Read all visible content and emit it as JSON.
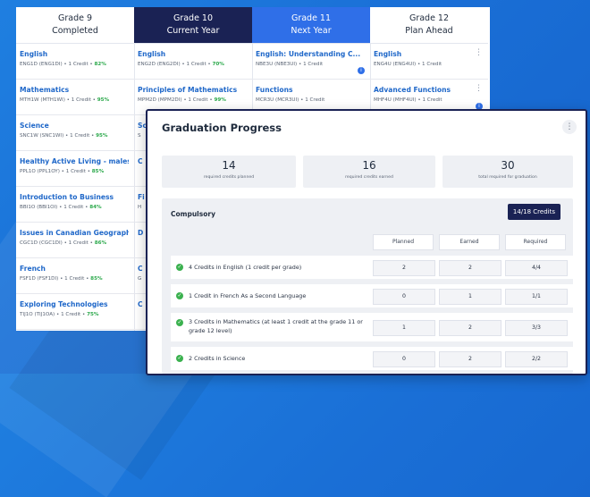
{
  "planner": {
    "columns": [
      {
        "line1": "Grade 9",
        "line2": "Completed",
        "courses": [
          {
            "title": "English",
            "sub": "ENG1D (ENG1DI) • 1 Credit • ",
            "pct": "82%"
          },
          {
            "title": "Mathematics",
            "sub": "MTH1W (MTH1WI) • 1 Credit • ",
            "pct": "95%"
          },
          {
            "title": "Science",
            "sub": "SNC1W (SNC1WI) • 1 Credit • ",
            "pct": "95%"
          },
          {
            "title": "Healthy Active Living - males",
            "sub": "PPL1O (PPL1OY) • 1 Credit • ",
            "pct": "85%"
          },
          {
            "title": "Introduction to Business",
            "sub": "BBI1O (BBI1OI) • 1 Credit • ",
            "pct": "84%"
          },
          {
            "title": "Issues in Canadian Geography",
            "sub": "CGC1D (CGC1DI) • 1 Credit • ",
            "pct": "86%"
          },
          {
            "title": "French",
            "sub": "FSF1D (FSF1DI) • 1 Credit • ",
            "pct": "85%"
          },
          {
            "title": "Exploring Technologies",
            "sub": "TIJ1O (TIJ1OA) • 1 Credit • ",
            "pct": "75%"
          }
        ]
      },
      {
        "line1": "Grade 10",
        "line2": "Current Year",
        "courses": [
          {
            "title": "English",
            "sub": "ENG2D (ENG2DI) • 1 Credit • ",
            "pct": "70%"
          },
          {
            "title": "Principles of Mathematics",
            "sub": "MPM2D (MPM2DI) • 1 Credit • ",
            "pct": "99%"
          },
          {
            "title": "Sc",
            "sub": "S",
            "pct": ""
          },
          {
            "title": "C",
            "sub": "",
            "pct": ""
          },
          {
            "title": "Fi",
            "sub": "H",
            "pct": ""
          },
          {
            "title": "D",
            "sub": "",
            "pct": ""
          },
          {
            "title": "C",
            "sub": "G",
            "pct": ""
          },
          {
            "title": "C",
            "sub": "",
            "pct": ""
          }
        ]
      },
      {
        "line1": "Grade 11",
        "line2": "Next Year",
        "courses": [
          {
            "title": "English: Understanding C...",
            "sub": "NBE3U (NBE3UI) • 1 Credit",
            "pct": ""
          },
          {
            "title": "Functions",
            "sub": "MCR3U (MCR3UI) • 1 Credit",
            "pct": ""
          }
        ]
      },
      {
        "line1": "Grade 12",
        "line2": "Plan Ahead",
        "courses": [
          {
            "title": "English",
            "sub": "ENG4U (ENG4UI) • 1 Credit",
            "pct": ""
          },
          {
            "title": "Advanced Functions",
            "sub": "MHF4U (MHF4UI) • 1 Credit",
            "pct": ""
          }
        ]
      }
    ]
  },
  "progress": {
    "title": "Graduation Progress",
    "stats": [
      {
        "num": "14",
        "label": "required credits planned"
      },
      {
        "num": "16",
        "label": "required credits earned"
      },
      {
        "num": "30",
        "label": "total required for graduation"
      }
    ],
    "section_label": "Compulsory",
    "badge": "14/18 Credits",
    "headers": [
      "Planned",
      "Earned",
      "Required"
    ],
    "rows": [
      {
        "text": "4 Credits in English (1 credit per grade)",
        "planned": "2",
        "earned": "2",
        "required": "4/4"
      },
      {
        "text": "1 Credit in French As a Second Language",
        "planned": "0",
        "earned": "1",
        "required": "1/1"
      },
      {
        "text": "3 Credits in Mathematics (at least 1 credit at the grade 11 or grade 12 level)",
        "planned": "1",
        "earned": "2",
        "required": "3/3"
      },
      {
        "text": "2 Credits in Science",
        "planned": "0",
        "earned": "2",
        "required": "2/2"
      }
    ]
  }
}
